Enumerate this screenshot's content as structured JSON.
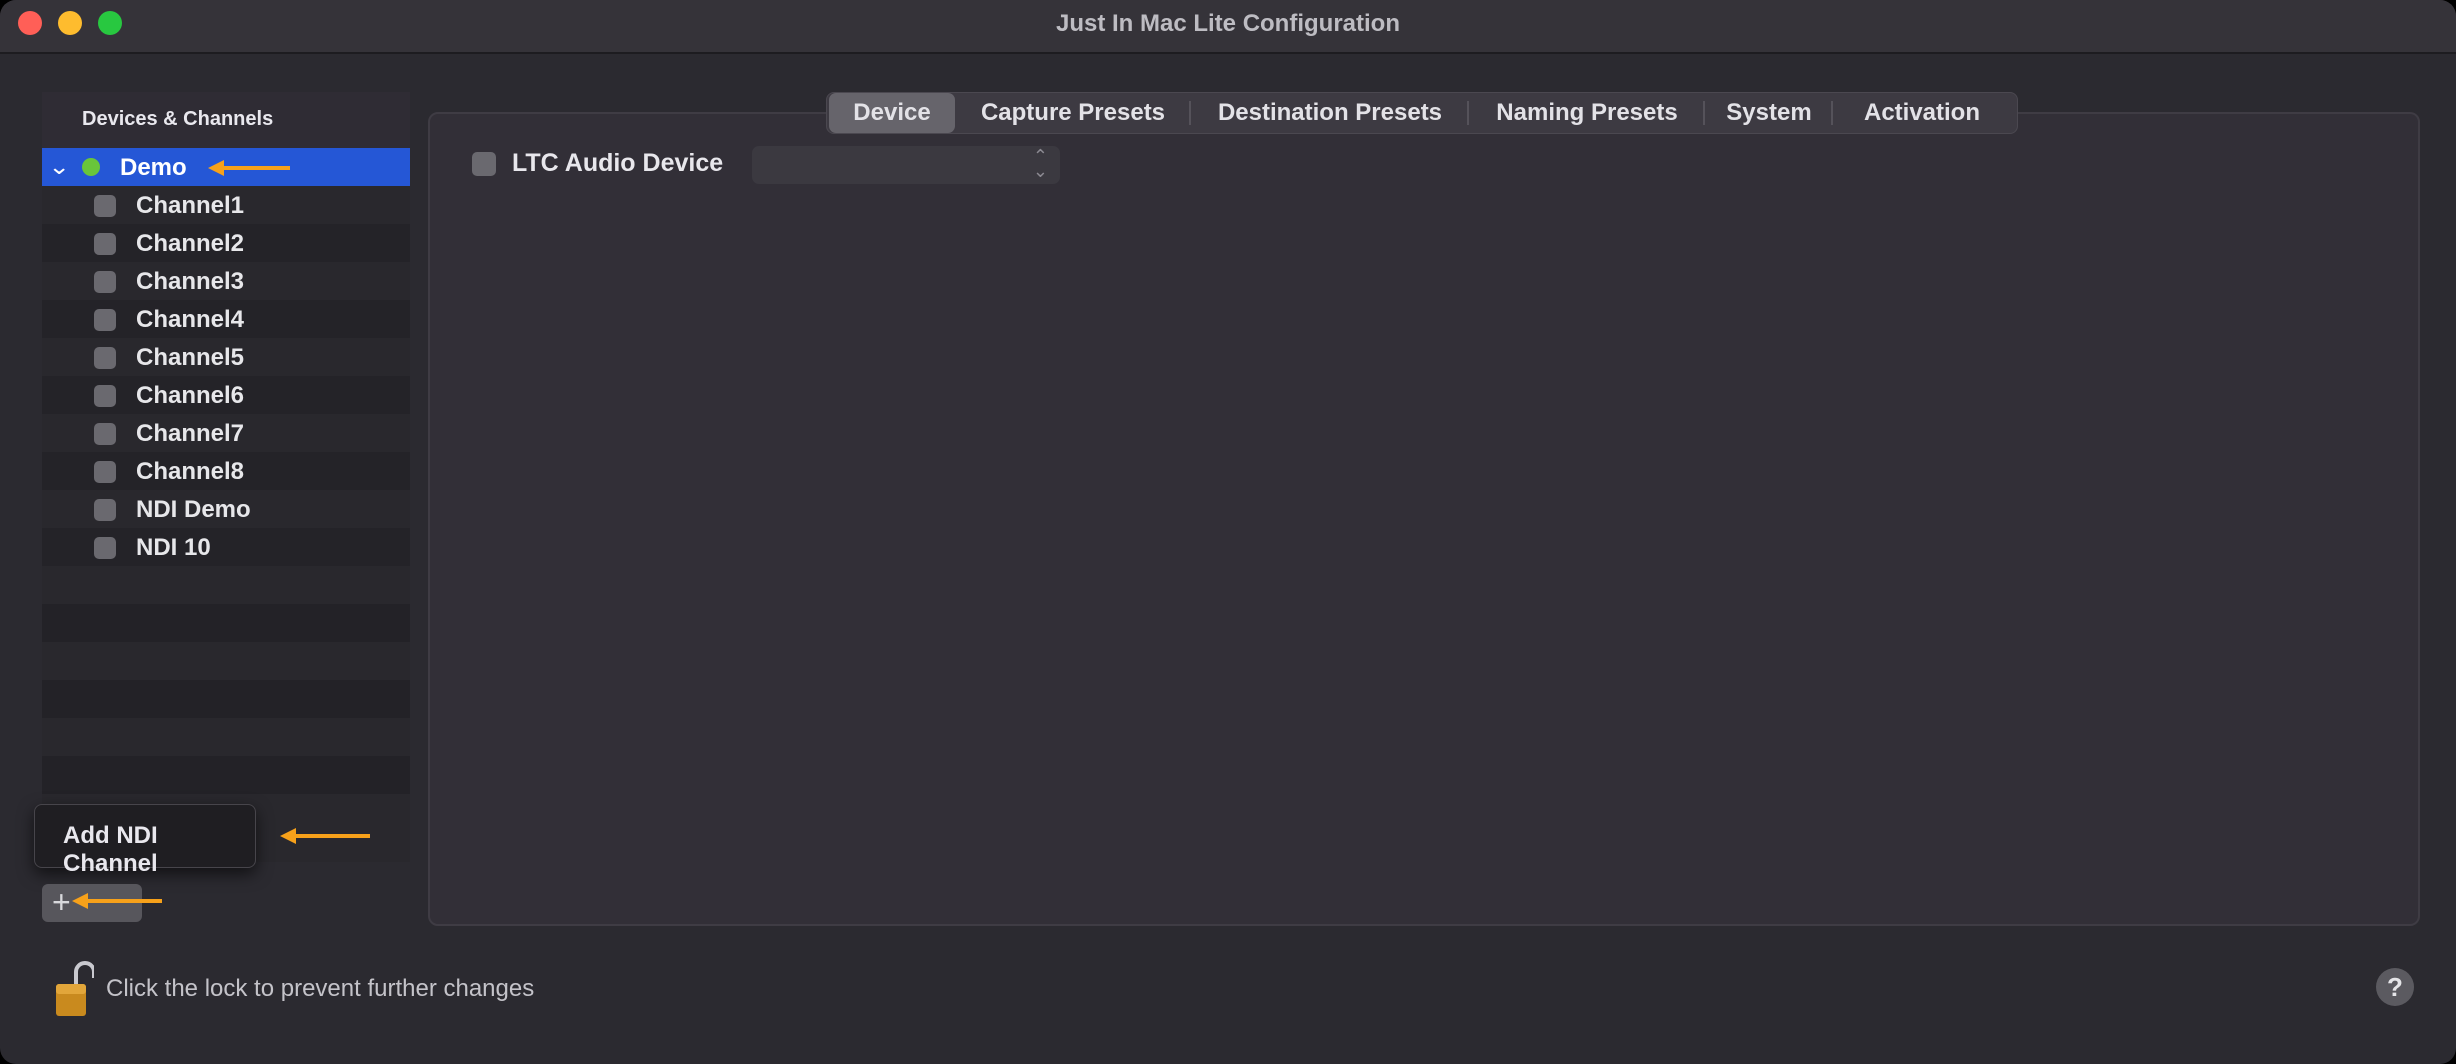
{
  "window": {
    "title": "Just In Mac Lite Configuration"
  },
  "sidebar": {
    "header": "Devices & Channels",
    "device": {
      "label": "Demo",
      "status_color": "#69c53b"
    },
    "channels": [
      {
        "label": "Channel1"
      },
      {
        "label": "Channel2"
      },
      {
        "label": "Channel3"
      },
      {
        "label": "Channel4"
      },
      {
        "label": "Channel5"
      },
      {
        "label": "Channel6"
      },
      {
        "label": "Channel7"
      },
      {
        "label": "Channel8"
      },
      {
        "label": "NDI Demo"
      },
      {
        "label": "NDI 10"
      }
    ],
    "add_button_label": "+",
    "popup_label": "Add NDI Channel"
  },
  "tabs": [
    {
      "label": "Device",
      "active": true
    },
    {
      "label": "Capture Presets"
    },
    {
      "label": "Destination Presets"
    },
    {
      "label": "Naming Presets"
    },
    {
      "label": "System"
    },
    {
      "label": "Activation"
    }
  ],
  "device_tab": {
    "ltc_label": "LTC Audio Device",
    "ltc_select_value": ""
  },
  "footer": {
    "lock_text": "Click the lock to prevent further changes",
    "help_label": "?"
  },
  "colors": {
    "selection": "#2557d6",
    "annotation_arrow": "#f7a11a"
  }
}
